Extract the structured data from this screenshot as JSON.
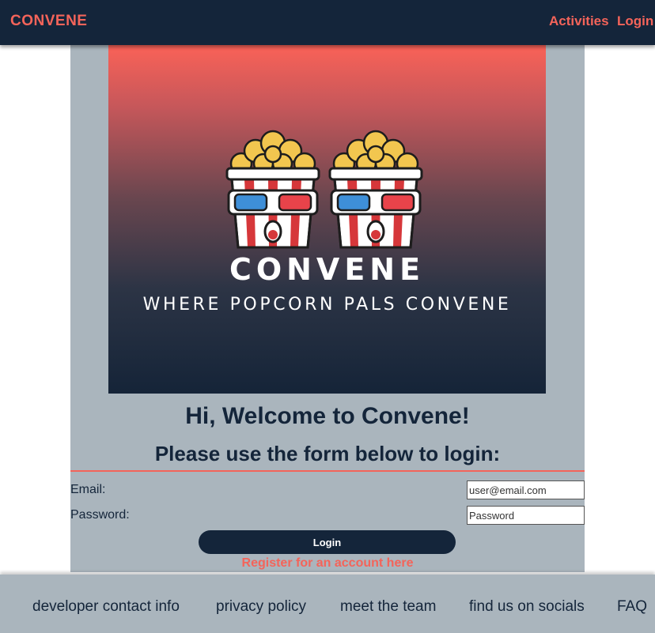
{
  "nav": {
    "brand": "CONVENE",
    "links": [
      "Activities",
      "Login"
    ]
  },
  "hero": {
    "logo_title": "CONVENE",
    "logo_tagline": "WHERE POPCORN PALS CONVENE",
    "logo_icons": [
      "popcorn-bucket-3d-glasses-icon",
      "popcorn-bucket-3d-glasses-icon"
    ]
  },
  "main": {
    "welcome": "Hi, Welcome to Convene!",
    "subtitle": "Please use the form below to login:"
  },
  "form": {
    "email_label": "Email:",
    "email_placeholder": "user@email.com",
    "password_label": "Password:",
    "password_placeholder": "Password",
    "submit_label": "Login",
    "register_link": "Register for an account here"
  },
  "footer": {
    "links": [
      "developer contact info",
      "privacy policy",
      "meet the team",
      "find us on socials",
      "FAQ"
    ]
  },
  "colors": {
    "navbar": "#14253a",
    "accent": "#f4645a",
    "panel": "#aab5bd",
    "text": "#14253a"
  }
}
